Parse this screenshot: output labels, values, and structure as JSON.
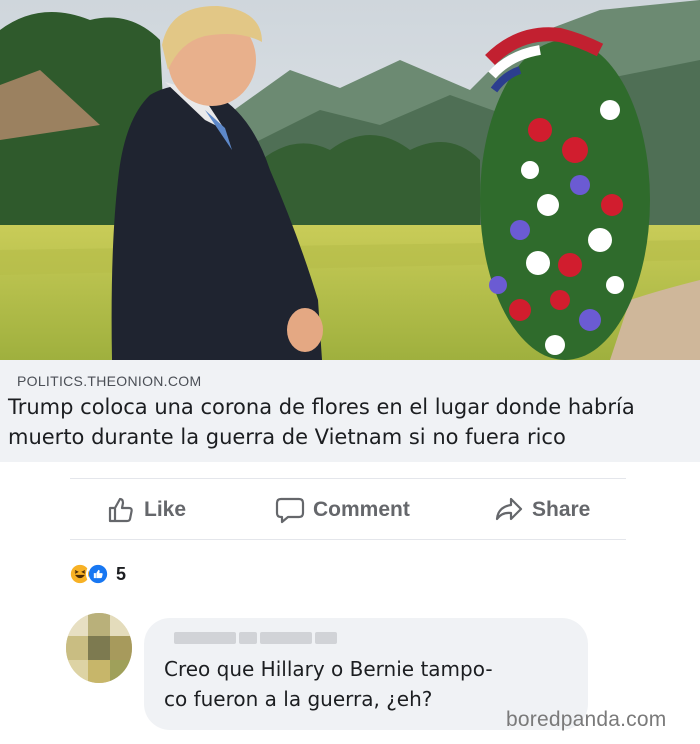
{
  "link_preview": {
    "domain": "POLITICS.THEONION.COM",
    "title": "Trump coloca una corona de flores en el lugar donde habría muerto durante la guerra de Vietnam si no fuera rico"
  },
  "actions": {
    "like_label": "Like",
    "comment_label": "Comment",
    "share_label": "Share"
  },
  "reactions": {
    "icons": [
      "haha-icon",
      "like-icon"
    ],
    "count": "5"
  },
  "comment": {
    "text": "Creo que Hillary o Bernie tampo-\nco fueron a la guerra, ¿eh?"
  },
  "watermark": "boredpanda.com",
  "colors": {
    "like_blue": "#1877f2",
    "haha_yellow": "#f7b125",
    "action_gray": "#65676b",
    "panel_gray": "#f0f2f5"
  }
}
